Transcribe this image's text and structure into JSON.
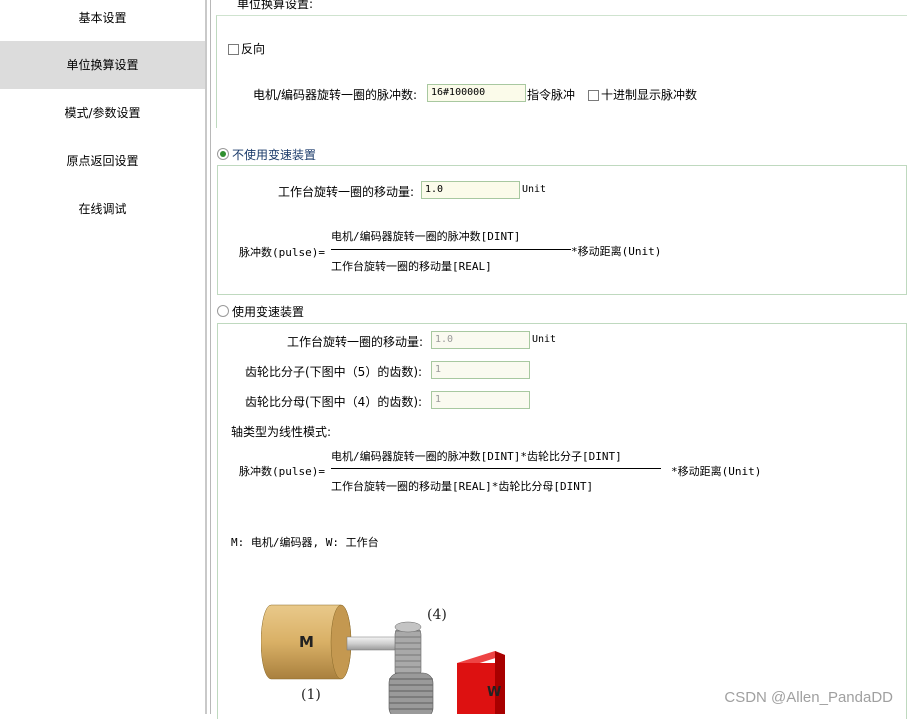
{
  "sidebar": {
    "items": [
      {
        "label": "基本设置"
      },
      {
        "label": "单位换算设置"
      },
      {
        "label": "模式/参数设置"
      },
      {
        "label": "原点返回设置"
      },
      {
        "label": "在线调试"
      }
    ],
    "active_index": 1
  },
  "header": {
    "section_title": "单位换算设置:"
  },
  "reverse": {
    "label": "反向",
    "checked": false
  },
  "encoder": {
    "label": "电机/编码器旋转一圈的脉冲数:",
    "value": "16#100000",
    "unit": "指令脉冲",
    "decimal_label": "十进制显示脉冲数",
    "decimal_checked": false
  },
  "no_gear": {
    "radio_label": "不使用变速装置",
    "selected": true,
    "move_label": "工作台旋转一圈的移动量:",
    "move_value": "1.0",
    "move_unit": "Unit",
    "formula": {
      "lhs": "脉冲数(pulse)=",
      "numerator": "电机/编码器旋转一圈的脉冲数[DINT]",
      "denominator": "工作台旋转一圈的移动量[REAL]",
      "rhs": "*移动距离(Unit)"
    }
  },
  "gear": {
    "radio_label": "使用变速装置",
    "selected": false,
    "move_label": "工作台旋转一圈的移动量:",
    "move_value": "1.0",
    "move_unit": "Unit",
    "num_label": "齿轮比分子(下图中（5）的齿数):",
    "num_value": "1",
    "den_label": "齿轮比分母(下图中（4）的齿数):",
    "den_value": "1",
    "linear_title": "轴类型为线性模式:",
    "formula": {
      "lhs": "脉冲数(pulse)=",
      "numerator": "电机/编码器旋转一圈的脉冲数[DINT]*齿轮比分子[DINT]",
      "denominator": "工作台旋转一圈的移动量[REAL]*齿轮比分母[DINT]",
      "rhs": "*移动距离(Unit)"
    },
    "legend": "M: 电机/编码器, W: 工作台",
    "diagram": {
      "motor_letter": "M",
      "work_letter": "W",
      "label_1": "(1)",
      "label_4": "(4)"
    }
  },
  "colors": {
    "motor": "#d9b066",
    "work": "#dd1111",
    "gear": "#a9a9a9",
    "radio_on": "#2f8f2f",
    "field_border": "#a8c8a0"
  },
  "watermark": "CSDN @Allen_PandaDD"
}
